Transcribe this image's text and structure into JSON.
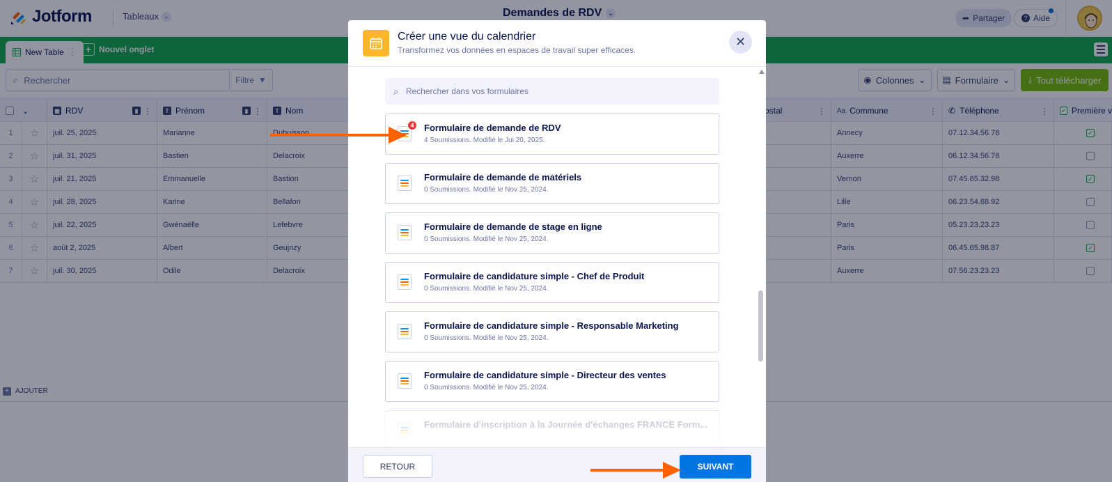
{
  "header": {
    "logo_text": "Jotform",
    "tables_menu": "Tableaux",
    "doc_title": "Demandes de RDV",
    "share_label": "Partager",
    "help_label": "Aide"
  },
  "tabs": {
    "active_label": "New Table",
    "new_tab_label": "Nouvel onglet"
  },
  "toolbar": {
    "search_placeholder": "Rechercher",
    "filter_label": "Filtre",
    "columns_label": "Colonnes",
    "form_label": "Formulaire",
    "download_label": "Tout télécharger"
  },
  "table": {
    "columns": {
      "rdv": "RDV",
      "prenom": "Prénom",
      "nom": "Nom",
      "postal": "ostal",
      "commune": "Commune",
      "telephone": "Téléphone",
      "premiere": "Première v"
    },
    "rows": [
      {
        "num": "1",
        "rdv": "juil. 25, 2025",
        "prenom": "Marianne",
        "nom": "Dubuisson",
        "commune": "Annecy",
        "tel": "07.12.34.56.78",
        "checked": true
      },
      {
        "num": "2",
        "rdv": "juil. 31, 2025",
        "prenom": "Bastien",
        "nom": "Delacroix",
        "commune": "Auxerre",
        "tel": "06.12.34.56.78",
        "checked": false
      },
      {
        "num": "3",
        "rdv": "juil. 21, 2025",
        "prenom": "Emmanuelle",
        "nom": "Bastion",
        "commune": "Vernon",
        "tel": "07.45.65.32.98",
        "checked": true
      },
      {
        "num": "4",
        "rdv": "juil. 28, 2025",
        "prenom": "Karine",
        "nom": "Bellafon",
        "commune": "Lille",
        "tel": "06.23.54.68.92",
        "checked": false
      },
      {
        "num": "5",
        "rdv": "juil. 22, 2025",
        "prenom": "Gwénaëlle",
        "nom": "Lefebvre",
        "commune": "Paris",
        "tel": "05.23.23.23.23",
        "checked": false
      },
      {
        "num": "6",
        "rdv": "août 2, 2025",
        "prenom": "Albert",
        "nom": "Geujnzy",
        "commune": "Paris",
        "tel": "06.45.65.98.87",
        "checked": true
      },
      {
        "num": "7",
        "rdv": "juil. 30, 2025",
        "prenom": "Odile",
        "nom": "Delacroix",
        "commune": "Auxerre",
        "tel": "07.56.23.23.23",
        "checked": false
      }
    ],
    "add_label": "AJOUTER"
  },
  "modal": {
    "title": "Créer une vue du calendrier",
    "subtitle": "Transformez vos données en espaces de travail super efficaces.",
    "search_placeholder": "Rechercher dans vos formulaires",
    "forms": [
      {
        "name": "Formulaire de demande de RDV",
        "meta": "4 Soumissions. Modifié le Jui 20, 2025.",
        "badge": "4"
      },
      {
        "name": "Formulaire de demande de matériels",
        "meta": "0 Soumissions. Modifié le Nov 25, 2024."
      },
      {
        "name": "Formulaire de demande de stage en ligne",
        "meta": "0 Soumissions. Modifié le Nov 25, 2024."
      },
      {
        "name": "Formulaire de candidature simple - Chef de Produit",
        "meta": "0 Soumissions. Modifié le Nov 25, 2024."
      },
      {
        "name": "Formulaire de candidature simple - Responsable Marketing",
        "meta": "0 Soumissions. Modifié le Nov 25, 2024."
      },
      {
        "name": "Formulaire de candidature simple - Directeur des ventes",
        "meta": "0 Soumissions. Modifié le Nov 25, 2024."
      },
      {
        "name": "Formulaire d'inscription à la Journée d'échanges FRANCE Form...",
        "meta": ""
      }
    ],
    "back_label": "RETOUR",
    "next_label": "SUIVANT"
  },
  "colors": {
    "brand_green": "#12a84a",
    "accent_blue": "#0075e3",
    "calendar_orange": "#ffb629",
    "annotation_arrow": "#ff6100"
  }
}
